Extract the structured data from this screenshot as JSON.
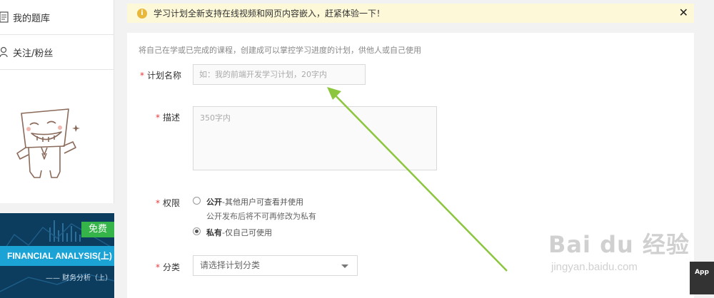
{
  "sidebar": {
    "items": [
      {
        "label": "我的题库",
        "icon": "document-icon"
      },
      {
        "label": "关注/粉丝",
        "icon": "user-icon"
      }
    ],
    "course": {
      "badge": "免费",
      "title": "FINANCIAL ANALYSIS(上)",
      "subtitle": "—— 财务分析（上）"
    }
  },
  "notice": {
    "text": "学习计划全新支持在线视频和网页内容嵌入，赶紧体验一下！"
  },
  "form": {
    "hint": "将自己在学或已完成的课程，创建成可以掌控学习进度的计划，供他人或自己使用",
    "name_label": "计划名称",
    "name_placeholder": "如：我的前端开发学习计划，20字内",
    "desc_label": "描述",
    "desc_placeholder": "350字内",
    "perm_label": "权限",
    "public_title": "公开",
    "public_desc": "-其他用户可查看并使用",
    "public_note": "公开发布后将不可再修改为私有",
    "private_title": "私有",
    "private_desc": "-仅自己可使用",
    "selected_permission": "私有",
    "category_label": "分类",
    "category_placeholder": "请选择计划分类"
  },
  "watermark": {
    "brand": "Bai du 经验",
    "url": "jingyan.baidu.com"
  },
  "app_tab": {
    "label": "App"
  },
  "colors": {
    "required": "#e4393c",
    "notice_bg": "#fdf8d7",
    "free_badge": "#35b44a",
    "arrow": "#8cc63f"
  }
}
